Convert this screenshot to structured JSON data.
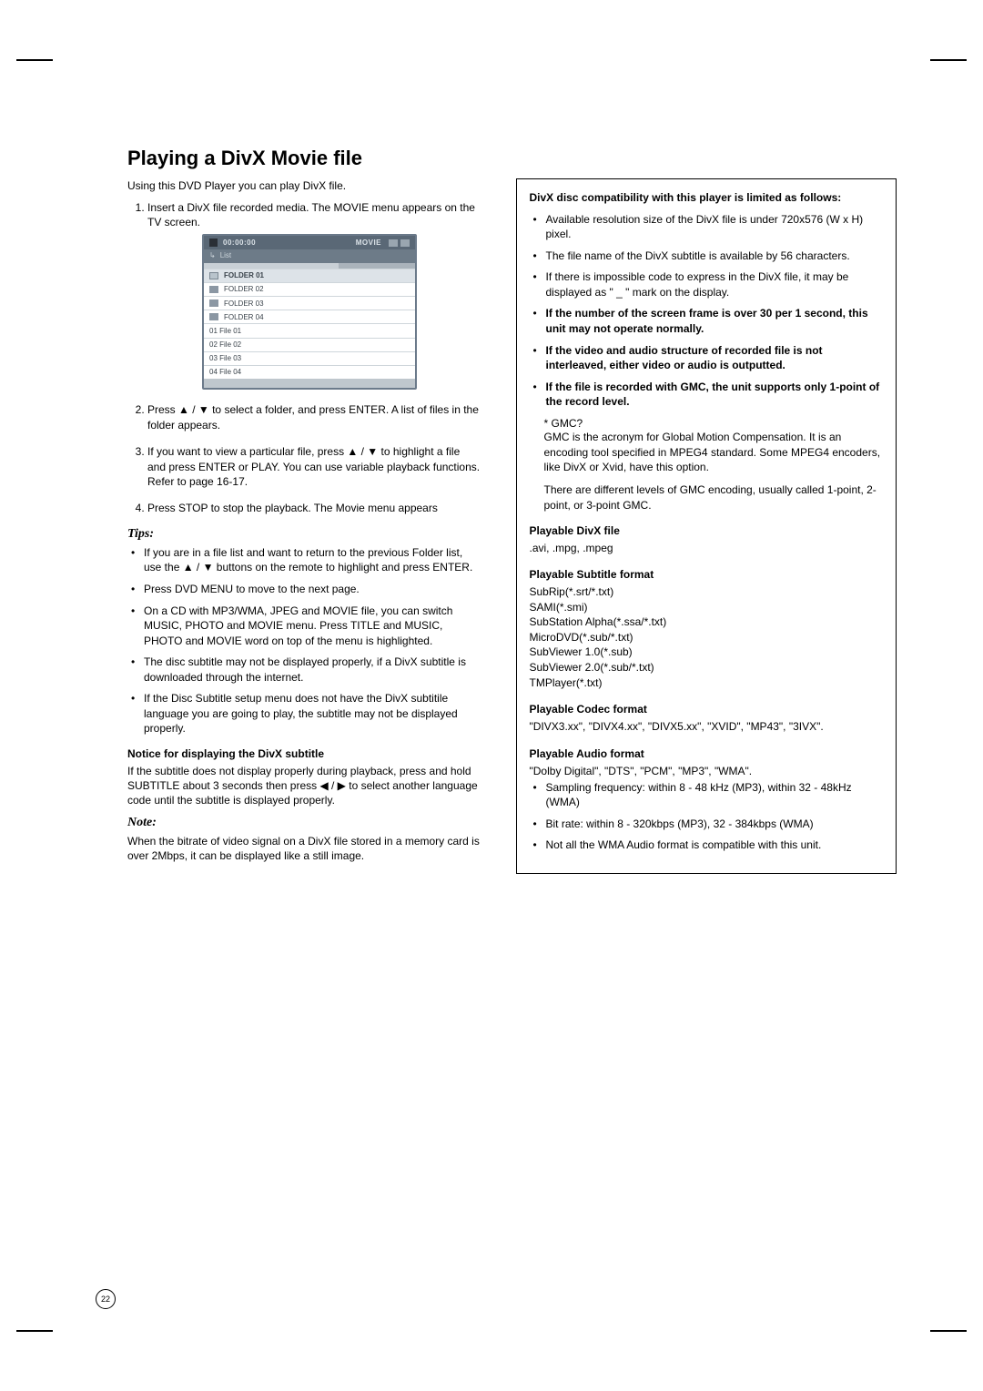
{
  "title": "Playing a DivX Movie file",
  "intro": "Using this DVD Player you can play DivX file.",
  "steps": [
    "Insert a DivX file recorded media. The MOVIE menu appears on the TV screen.",
    "Press ▲ / ▼ to select a folder, and press ENTER. A list of files in the folder appears.",
    "If you want to view a particular file, press ▲ / ▼ to highlight a file and press ENTER or PLAY. You can use variable playback functions. Refer to page 16-17.",
    "Press STOP to stop the playback. The Movie menu appears"
  ],
  "menu": {
    "label": "MOVIE",
    "time": "00:00:00",
    "sub": "List",
    "rows": [
      {
        "icon": "sel",
        "text": "FOLDER 01"
      },
      {
        "icon": "folder",
        "text": "FOLDER 02"
      },
      {
        "icon": "folder",
        "text": "FOLDER 03"
      },
      {
        "icon": "folder",
        "text": "FOLDER 04"
      },
      {
        "icon": "",
        "text": "01 File 01"
      },
      {
        "icon": "",
        "text": "02 File 02"
      },
      {
        "icon": "",
        "text": "03 File 03"
      },
      {
        "icon": "",
        "text": "04 File 04"
      }
    ]
  },
  "tips_heading": "Tips:",
  "tips": [
    "If you are in a file list and want to return to the previous Folder list, use the ▲ / ▼ buttons on the remote to highlight   and press ENTER.",
    "Press DVD MENU to move to the next page.",
    "On a CD with MP3/WMA, JPEG and MOVIE file, you can switch MUSIC, PHOTO and MOVIE menu. Press TITLE and MUSIC, PHOTO and MOVIE word on top of the menu is highlighted.",
    "The disc subtitle may not be displayed properly, if a DivX subtitle is downloaded through the internet.",
    "If the Disc Subtitle setup menu does not have the DivX subtitile language you are going to play, the subtitle may not be displayed properly."
  ],
  "notice_heading": "Notice for displaying the DivX subtitle",
  "notice_body": "If the subtitle does not display properly during playback, press and hold SUBTITLE about 3 seconds then press ◀ / ▶ to select another language code until the subtitle is displayed properly.",
  "note_heading": "Note:",
  "note_body": "When the bitrate of video signal on a DivX file stored in a memory card is over 2Mbps, it can be displayed like a still image.",
  "right": {
    "compat_heading": "DivX disc compatibility with this player is limited as follows:",
    "compat_items": [
      {
        "bold": false,
        "text": "Available resolution size of the DivX file is under 720x576 (W x H) pixel."
      },
      {
        "bold": false,
        "text": "The file name of the DivX subtitle is available by 56 characters."
      },
      {
        "bold": false,
        "text": "If there is impossible code to express in the DivX file, it may be displayed as \" _ \" mark on the display."
      },
      {
        "bold": true,
        "text": "If the number of the screen frame is over 30 per 1 second, this unit may not operate normally."
      },
      {
        "bold": true,
        "text": "If the video and audio structure of recorded file is not interleaved, either video or audio is outputted."
      },
      {
        "bold": true,
        "text": "If the file is recorded with GMC, the unit supports only 1-point of the record level."
      }
    ],
    "gmc_star": "* GMC?",
    "gmc_body1": "GMC is the acronym for Global Motion Compensation. It is an encoding tool specified in MPEG4 standard. Some MPEG4 encoders, like DivX or Xvid, have this option.",
    "gmc_body2": "There are different levels of GMC encoding, usually called 1-point, 2-point, or 3-point GMC.",
    "divx_heading": "Playable DivX file",
    "divx_ext": ".avi, .mpg, .mpeg",
    "sub_heading": "Playable Subtitle format",
    "sub_list": "SubRip(*.srt/*.txt)\nSAMI(*.smi)\nSubStation Alpha(*.ssa/*.txt)\nMicroDVD(*.sub/*.txt)\nSubViewer 1.0(*.sub)\nSubViewer 2.0(*.sub/*.txt)\nTMPlayer(*.txt)",
    "codec_heading": "Playable Codec format",
    "codec_list": "\"DIVX3.xx\", \"DIVX4.xx\", \"DIVX5.xx\", \"XVID\", \"MP43\", \"3IVX\".",
    "audio_heading": "Playable Audio format",
    "audio_intro": "\"Dolby Digital\", \"DTS\", \"PCM\", \"MP3\", \"WMA\".",
    "audio_items": [
      "Sampling frequency: within 8 - 48 kHz (MP3), within 32 - 48kHz (WMA)",
      "Bit rate: within 8 - 320kbps (MP3), 32 - 384kbps (WMA)",
      "Not all the WMA Audio format is compatible with this unit."
    ]
  },
  "page_number": "22"
}
